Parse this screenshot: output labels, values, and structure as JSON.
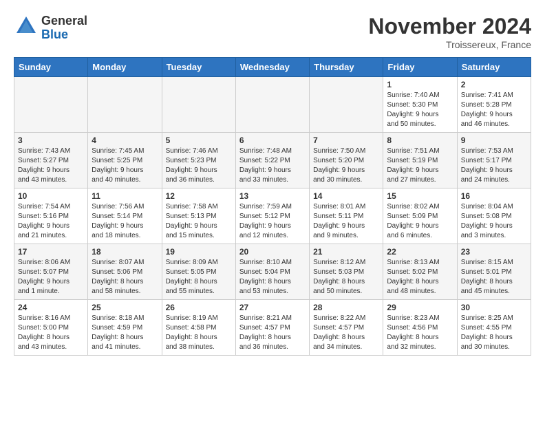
{
  "header": {
    "logo_general": "General",
    "logo_blue": "Blue",
    "month_title": "November 2024",
    "location": "Troissereux, France"
  },
  "days_of_week": [
    "Sunday",
    "Monday",
    "Tuesday",
    "Wednesday",
    "Thursday",
    "Friday",
    "Saturday"
  ],
  "weeks": [
    [
      {
        "day": "",
        "info": ""
      },
      {
        "day": "",
        "info": ""
      },
      {
        "day": "",
        "info": ""
      },
      {
        "day": "",
        "info": ""
      },
      {
        "day": "",
        "info": ""
      },
      {
        "day": "1",
        "info": "Sunrise: 7:40 AM\nSunset: 5:30 PM\nDaylight: 9 hours\nand 50 minutes."
      },
      {
        "day": "2",
        "info": "Sunrise: 7:41 AM\nSunset: 5:28 PM\nDaylight: 9 hours\nand 46 minutes."
      }
    ],
    [
      {
        "day": "3",
        "info": "Sunrise: 7:43 AM\nSunset: 5:27 PM\nDaylight: 9 hours\nand 43 minutes."
      },
      {
        "day": "4",
        "info": "Sunrise: 7:45 AM\nSunset: 5:25 PM\nDaylight: 9 hours\nand 40 minutes."
      },
      {
        "day": "5",
        "info": "Sunrise: 7:46 AM\nSunset: 5:23 PM\nDaylight: 9 hours\nand 36 minutes."
      },
      {
        "day": "6",
        "info": "Sunrise: 7:48 AM\nSunset: 5:22 PM\nDaylight: 9 hours\nand 33 minutes."
      },
      {
        "day": "7",
        "info": "Sunrise: 7:50 AM\nSunset: 5:20 PM\nDaylight: 9 hours\nand 30 minutes."
      },
      {
        "day": "8",
        "info": "Sunrise: 7:51 AM\nSunset: 5:19 PM\nDaylight: 9 hours\nand 27 minutes."
      },
      {
        "day": "9",
        "info": "Sunrise: 7:53 AM\nSunset: 5:17 PM\nDaylight: 9 hours\nand 24 minutes."
      }
    ],
    [
      {
        "day": "10",
        "info": "Sunrise: 7:54 AM\nSunset: 5:16 PM\nDaylight: 9 hours\nand 21 minutes."
      },
      {
        "day": "11",
        "info": "Sunrise: 7:56 AM\nSunset: 5:14 PM\nDaylight: 9 hours\nand 18 minutes."
      },
      {
        "day": "12",
        "info": "Sunrise: 7:58 AM\nSunset: 5:13 PM\nDaylight: 9 hours\nand 15 minutes."
      },
      {
        "day": "13",
        "info": "Sunrise: 7:59 AM\nSunset: 5:12 PM\nDaylight: 9 hours\nand 12 minutes."
      },
      {
        "day": "14",
        "info": "Sunrise: 8:01 AM\nSunset: 5:11 PM\nDaylight: 9 hours\nand 9 minutes."
      },
      {
        "day": "15",
        "info": "Sunrise: 8:02 AM\nSunset: 5:09 PM\nDaylight: 9 hours\nand 6 minutes."
      },
      {
        "day": "16",
        "info": "Sunrise: 8:04 AM\nSunset: 5:08 PM\nDaylight: 9 hours\nand 3 minutes."
      }
    ],
    [
      {
        "day": "17",
        "info": "Sunrise: 8:06 AM\nSunset: 5:07 PM\nDaylight: 9 hours\nand 1 minute."
      },
      {
        "day": "18",
        "info": "Sunrise: 8:07 AM\nSunset: 5:06 PM\nDaylight: 8 hours\nand 58 minutes."
      },
      {
        "day": "19",
        "info": "Sunrise: 8:09 AM\nSunset: 5:05 PM\nDaylight: 8 hours\nand 55 minutes."
      },
      {
        "day": "20",
        "info": "Sunrise: 8:10 AM\nSunset: 5:04 PM\nDaylight: 8 hours\nand 53 minutes."
      },
      {
        "day": "21",
        "info": "Sunrise: 8:12 AM\nSunset: 5:03 PM\nDaylight: 8 hours\nand 50 minutes."
      },
      {
        "day": "22",
        "info": "Sunrise: 8:13 AM\nSunset: 5:02 PM\nDaylight: 8 hours\nand 48 minutes."
      },
      {
        "day": "23",
        "info": "Sunrise: 8:15 AM\nSunset: 5:01 PM\nDaylight: 8 hours\nand 45 minutes."
      }
    ],
    [
      {
        "day": "24",
        "info": "Sunrise: 8:16 AM\nSunset: 5:00 PM\nDaylight: 8 hours\nand 43 minutes."
      },
      {
        "day": "25",
        "info": "Sunrise: 8:18 AM\nSunset: 4:59 PM\nDaylight: 8 hours\nand 41 minutes."
      },
      {
        "day": "26",
        "info": "Sunrise: 8:19 AM\nSunset: 4:58 PM\nDaylight: 8 hours\nand 38 minutes."
      },
      {
        "day": "27",
        "info": "Sunrise: 8:21 AM\nSunset: 4:57 PM\nDaylight: 8 hours\nand 36 minutes."
      },
      {
        "day": "28",
        "info": "Sunrise: 8:22 AM\nSunset: 4:57 PM\nDaylight: 8 hours\nand 34 minutes."
      },
      {
        "day": "29",
        "info": "Sunrise: 8:23 AM\nSunset: 4:56 PM\nDaylight: 8 hours\nand 32 minutes."
      },
      {
        "day": "30",
        "info": "Sunrise: 8:25 AM\nSunset: 4:55 PM\nDaylight: 8 hours\nand 30 minutes."
      }
    ]
  ]
}
